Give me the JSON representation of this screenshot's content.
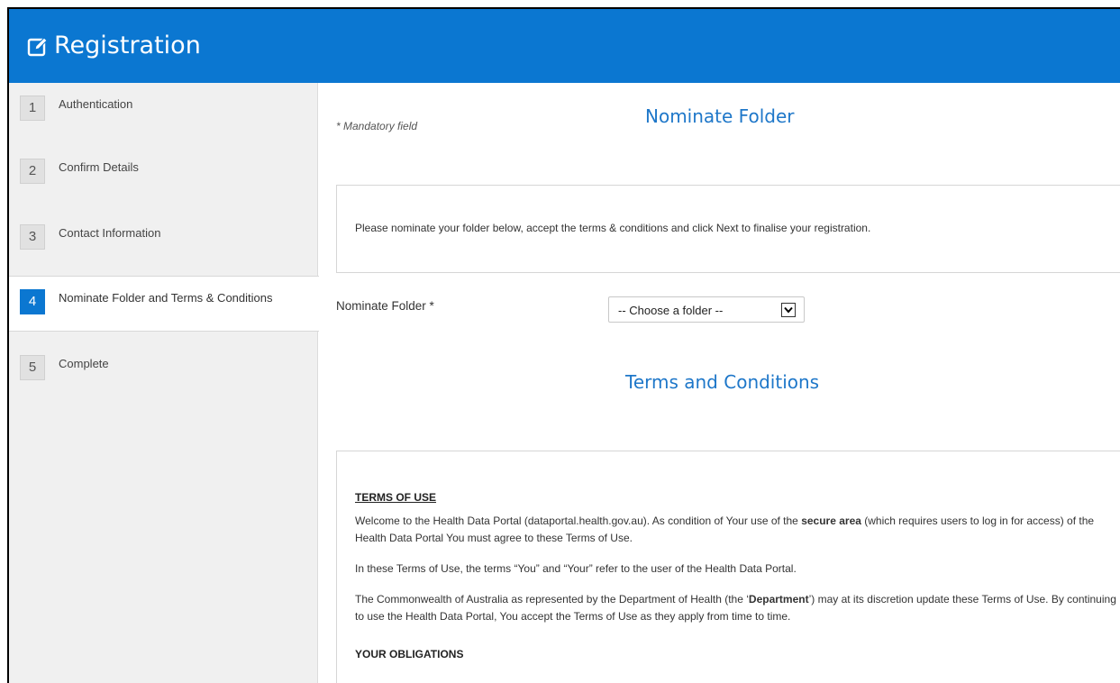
{
  "header": {
    "title": "Registration",
    "icon": "edit-icon",
    "color": "#0b77d1"
  },
  "sidebar": {
    "steps": [
      {
        "number": "1",
        "label": "Authentication"
      },
      {
        "number": "2",
        "label": "Confirm Details"
      },
      {
        "number": "3",
        "label": "Contact Information"
      },
      {
        "number": "4",
        "label": "Nominate Folder and Terms & Conditions",
        "active": true
      },
      {
        "number": "5",
        "label": "Complete"
      }
    ]
  },
  "main": {
    "mandatory_note": "* Mandatory field",
    "nominate_heading": "Nominate Folder",
    "instructions": "Please nominate your folder below, accept the terms & conditions and click Next to finalise your registration.",
    "folder_field": {
      "label": "Nominate Folder *",
      "selected": "-- Choose a folder --"
    },
    "terms_heading": "Terms and Conditions",
    "terms": {
      "title": "TERMS OF USE",
      "p1_a": "Welcome to the Health Data Portal (dataportal.health.gov.au). As condition of Your use of the ",
      "p1_bold": "secure area",
      "p1_b": " (which requires users to log in for access) of the Health Data Portal You must agree to these Terms of Use.",
      "p2": "In these Terms of Use, the terms “You” and “Your” refer to the user of the Health Data Portal.",
      "p3_a": "The Commonwealth of Australia as represented by the Department of Health (the ‘",
      "p3_bold": "Department",
      "p3_b": "’) may at its discretion update these Terms of Use.  By continuing to use the Health Data Portal, You accept the Terms of Use as they apply from time to time.",
      "obligations_heading": "YOUR OBLIGATIONS"
    }
  },
  "colors": {
    "accent": "#0b77d1",
    "heading": "#1e77c9"
  }
}
